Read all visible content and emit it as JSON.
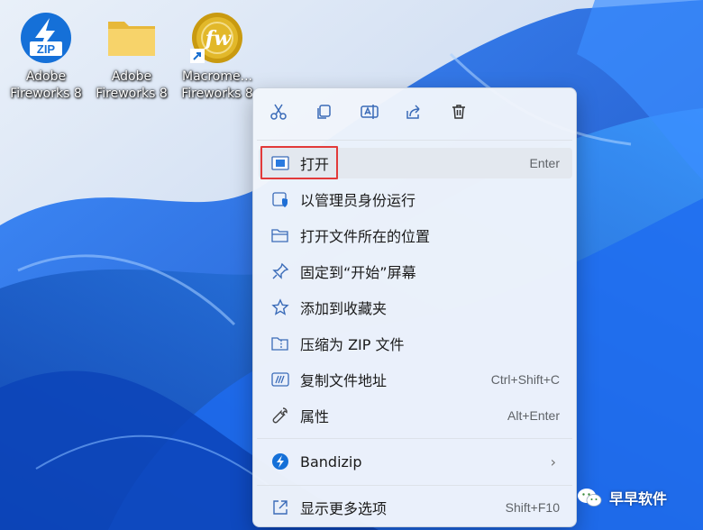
{
  "desktop": {
    "icons": [
      {
        "line1": "Adobe",
        "line2": "Fireworks 8",
        "icon": "zip-archive-icon"
      },
      {
        "line1": "Adobe",
        "line2": "Fireworks 8",
        "icon": "folder-icon"
      },
      {
        "line1": "Macrome...",
        "line2": "Fireworks 8",
        "icon": "fireworks-app-icon"
      }
    ]
  },
  "menu": {
    "quick_actions": [
      "cut-icon",
      "copy-icon",
      "rename-icon",
      "share-icon",
      "delete-icon"
    ],
    "items": [
      {
        "label": "打开",
        "shortcut": "Enter",
        "icon": "open-icon"
      },
      {
        "label": "以管理员身份运行",
        "shortcut": "",
        "icon": "admin-shield-icon"
      },
      {
        "label": "打开文件所在的位置",
        "shortcut": "",
        "icon": "folder-open-icon"
      },
      {
        "label": "固定到“开始”屏幕",
        "shortcut": "",
        "icon": "pin-icon"
      },
      {
        "label": "添加到收藏夹",
        "shortcut": "",
        "icon": "star-icon"
      },
      {
        "label": "压缩为 ZIP 文件",
        "shortcut": "",
        "icon": "zip-folder-icon"
      },
      {
        "label": "复制文件地址",
        "shortcut": "Ctrl+Shift+C",
        "icon": "copy-path-icon"
      },
      {
        "label": "属性",
        "shortcut": "Alt+Enter",
        "icon": "wrench-icon"
      }
    ],
    "bandizip": {
      "label": "Bandizip",
      "icon": "bandizip-icon"
    },
    "more": {
      "label": "显示更多选项",
      "shortcut": "Shift+F10",
      "icon": "more-options-icon"
    }
  },
  "watermark": {
    "text": "早早软件"
  },
  "colors": {
    "accent": "#0067c0",
    "highlight_border": "#e23a3a",
    "wallpaper_blue": "#1a5fd6"
  }
}
